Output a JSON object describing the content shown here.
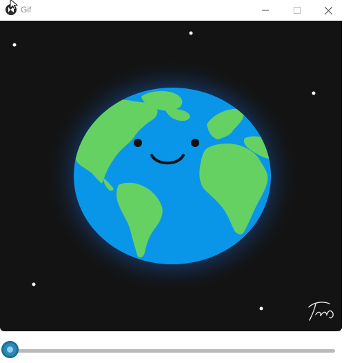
{
  "window": {
    "title": "Gif",
    "app_icon": "kivy-logo-icon",
    "controls": [
      "minimize-icon",
      "maximize-icon",
      "close-icon"
    ]
  },
  "animation": {
    "scene": "smiling-earth",
    "signature": "Tatus"
  },
  "playback": {
    "progress": 0.0
  },
  "colors": {
    "background": "#131313",
    "ocean": "#0a96e8",
    "land": "#66d163",
    "glow": "#1c6ed0",
    "slider_accent": "#2e89b7",
    "slider_track": "#b9b9b9"
  }
}
